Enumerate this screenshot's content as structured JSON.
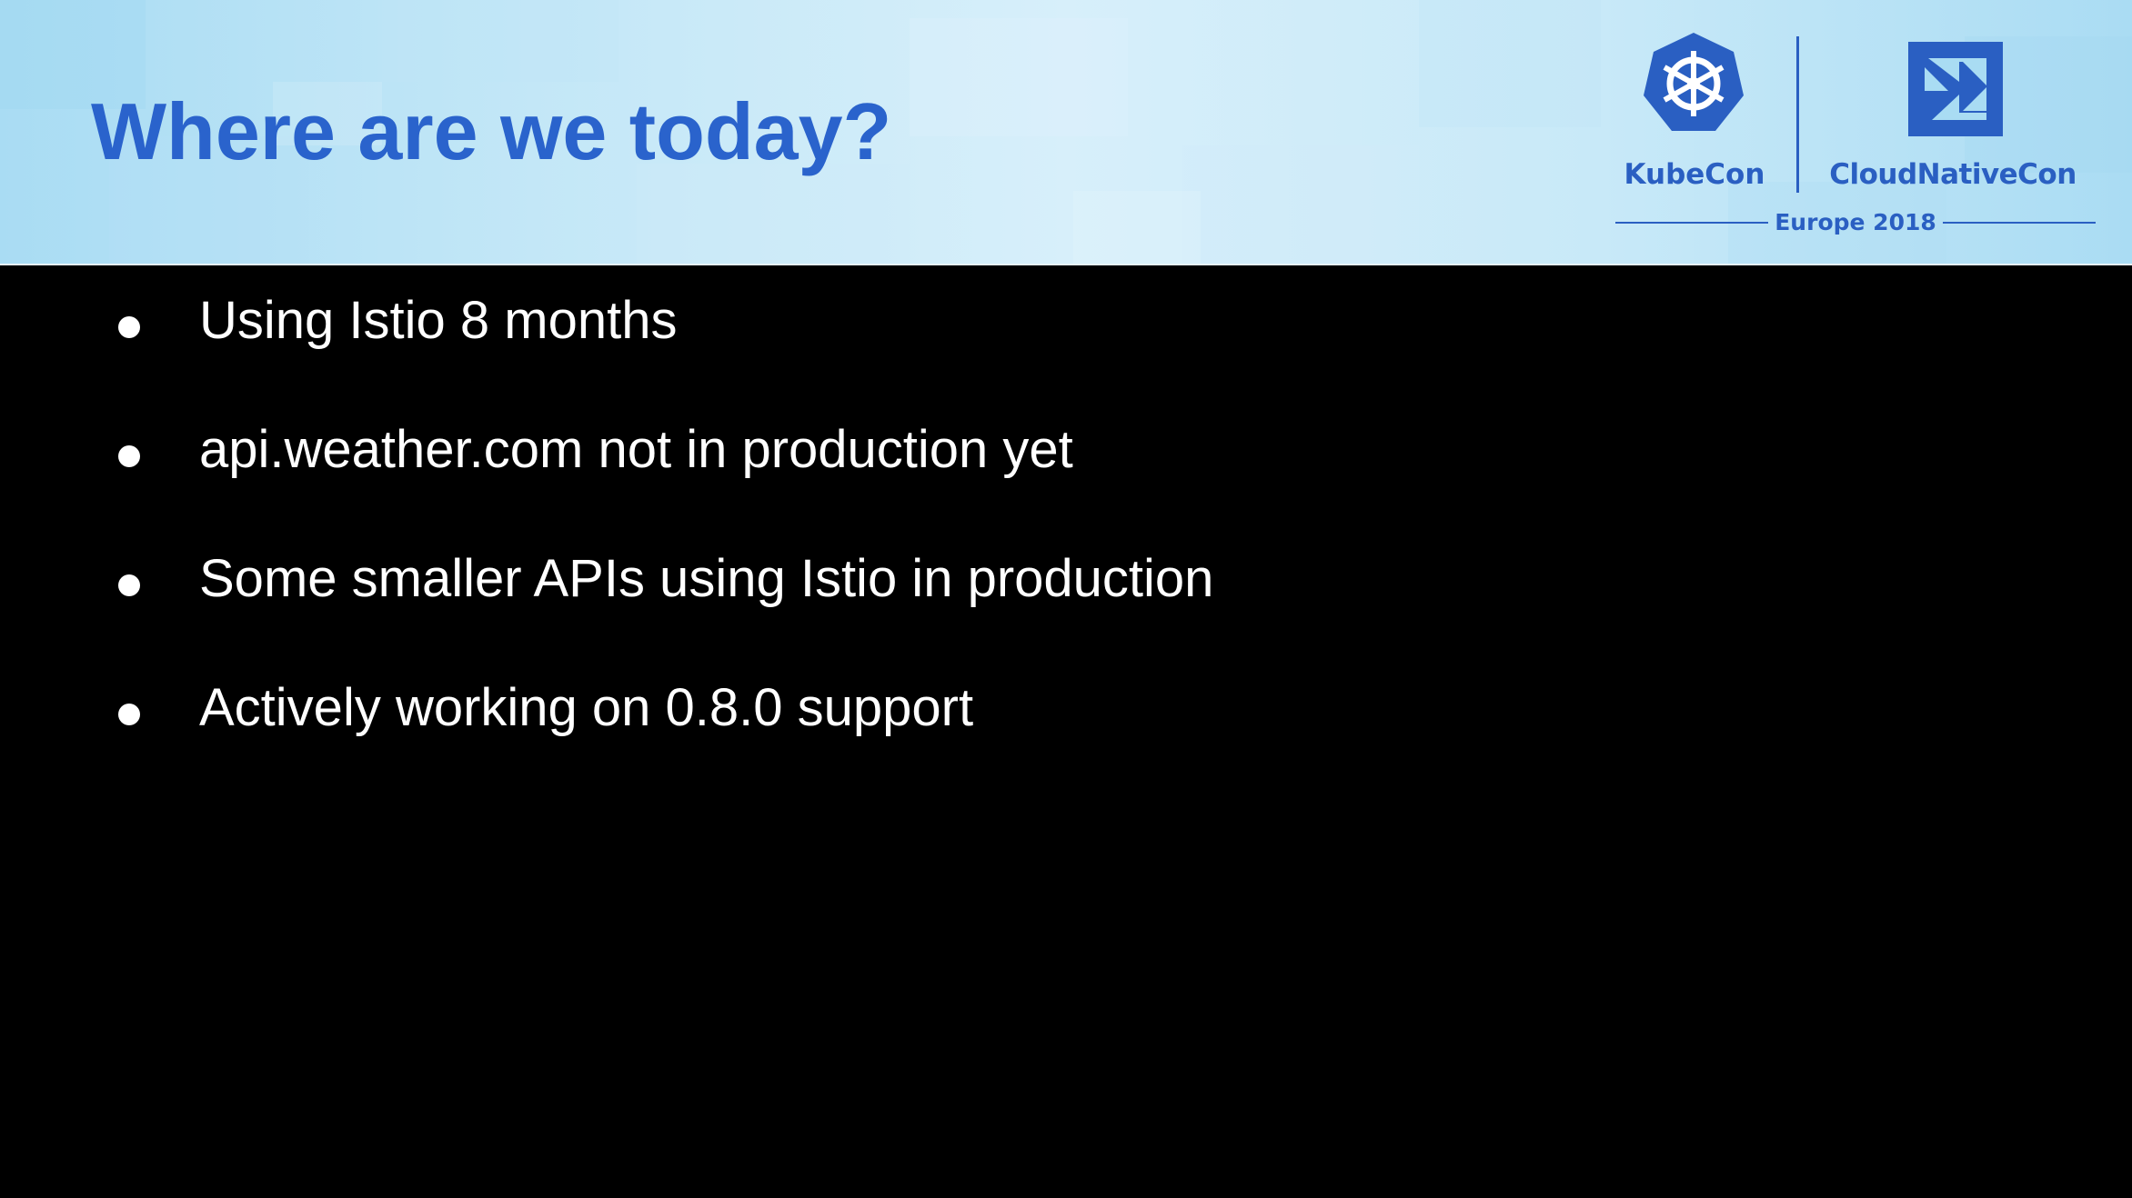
{
  "slide": {
    "title": "Where are we today?",
    "bullets": [
      "Using Istio 8 months",
      "api.weather.com not in production yet",
      "Some smaller APIs using Istio in production",
      "Actively working on 0.8.0 support"
    ]
  },
  "branding": {
    "kubecon_label": "KubeCon",
    "cloudnativecon_label": "CloudNativeCon",
    "event_label": "Europe 2018",
    "kubecon_icon": "kubernetes-helm-icon",
    "cncf_icon": "cncf-logo-icon"
  },
  "colors": {
    "title": "#2a63cc",
    "brand_blue": "#2a5fc2",
    "body_background": "#000000",
    "body_text": "#ffffff",
    "header_background": "#c3e7f7"
  }
}
